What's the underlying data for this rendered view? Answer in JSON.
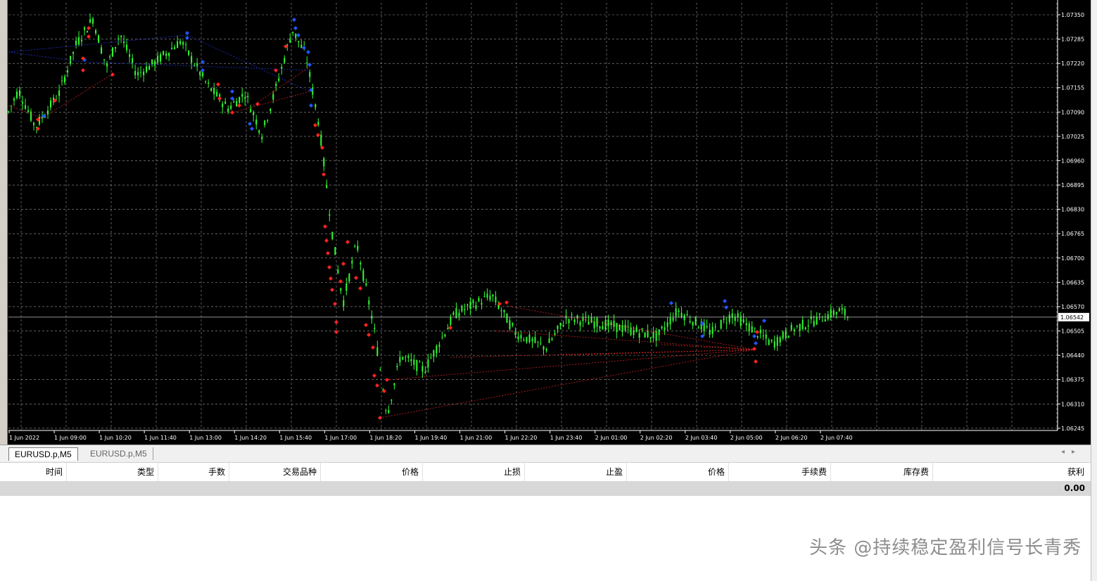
{
  "chart": {
    "symbol_tabs": [
      {
        "label": "EURUSD.p,M5",
        "active": true
      },
      {
        "label": "EURUSD.p,M5",
        "active": false
      }
    ],
    "current_price": "1.06542",
    "price_ticks": [
      "1.07350",
      "1.07285",
      "1.07220",
      "1.07155",
      "1.07090",
      "1.07025",
      "1.06960",
      "1.06895",
      "1.06830",
      "1.06765",
      "1.06700",
      "1.06635",
      "1.06570",
      "1.06505",
      "1.06440",
      "1.06375",
      "1.06310",
      "1.06245"
    ],
    "time_ticks": [
      "1 Jun 2022",
      "1 Jun 09:00",
      "1 Jun 10:20",
      "1 Jun 11:40",
      "1 Jun 13:00",
      "1 Jun 14:20",
      "1 Jun 15:40",
      "1 Jun 17:00",
      "1 Jun 18:20",
      "1 Jun 19:40",
      "1 Jun 21:00",
      "1 Jun 22:20",
      "1 Jun 23:40",
      "2 Jun 01:00",
      "2 Jun 02:20",
      "2 Jun 03:40",
      "2 Jun 05:00",
      "2 Jun 06:20",
      "2 Jun 07:40"
    ],
    "colors": {
      "background": "#000000",
      "grid": "#9a9a9a",
      "candle": "#33ff33",
      "buy_arrow": "#2255ff",
      "sell_arrow": "#ff2222",
      "buy_line": "#2233cc",
      "sell_line": "#cc2222",
      "price_line": "#c0c0c0"
    }
  },
  "tab_scroll": {
    "left": "◂",
    "right": "▸"
  },
  "terminal": {
    "columns": [
      "时间",
      "类型",
      "手数",
      "交易品种",
      "价格",
      "止损",
      "止盈",
      "价格",
      "手续费",
      "库存费",
      "获利"
    ],
    "total_profit": "0.00"
  },
  "watermark": "头条 @持续稳定盈利信号长青秀"
}
